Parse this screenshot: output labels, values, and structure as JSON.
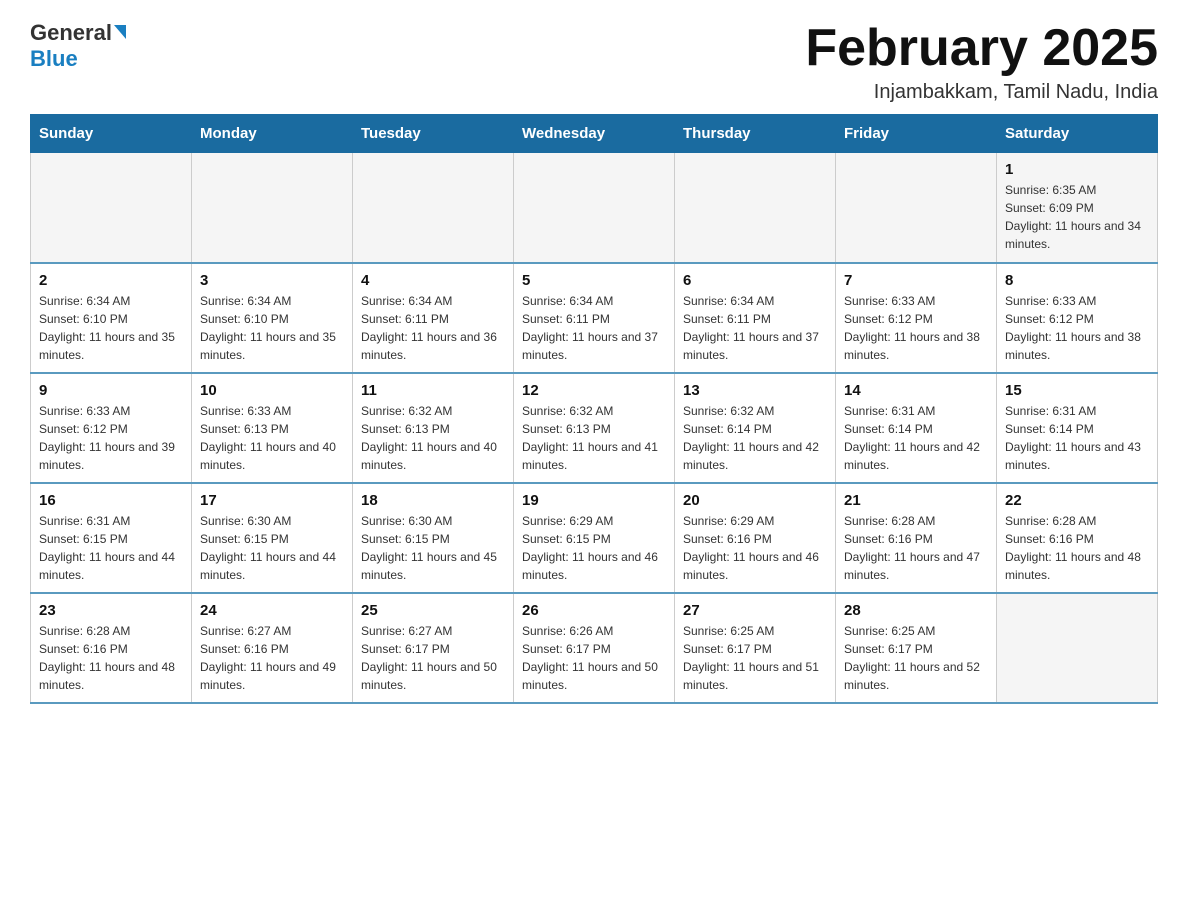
{
  "logo": {
    "general": "General",
    "blue": "Blue"
  },
  "header": {
    "title": "February 2025",
    "subtitle": "Injambakkam, Tamil Nadu, India"
  },
  "days_of_week": [
    "Sunday",
    "Monday",
    "Tuesday",
    "Wednesday",
    "Thursday",
    "Friday",
    "Saturday"
  ],
  "weeks": [
    {
      "days": [
        {
          "num": "",
          "info": ""
        },
        {
          "num": "",
          "info": ""
        },
        {
          "num": "",
          "info": ""
        },
        {
          "num": "",
          "info": ""
        },
        {
          "num": "",
          "info": ""
        },
        {
          "num": "",
          "info": ""
        },
        {
          "num": "1",
          "info": "Sunrise: 6:35 AM\nSunset: 6:09 PM\nDaylight: 11 hours and 34 minutes."
        }
      ]
    },
    {
      "days": [
        {
          "num": "2",
          "info": "Sunrise: 6:34 AM\nSunset: 6:10 PM\nDaylight: 11 hours and 35 minutes."
        },
        {
          "num": "3",
          "info": "Sunrise: 6:34 AM\nSunset: 6:10 PM\nDaylight: 11 hours and 35 minutes."
        },
        {
          "num": "4",
          "info": "Sunrise: 6:34 AM\nSunset: 6:11 PM\nDaylight: 11 hours and 36 minutes."
        },
        {
          "num": "5",
          "info": "Sunrise: 6:34 AM\nSunset: 6:11 PM\nDaylight: 11 hours and 37 minutes."
        },
        {
          "num": "6",
          "info": "Sunrise: 6:34 AM\nSunset: 6:11 PM\nDaylight: 11 hours and 37 minutes."
        },
        {
          "num": "7",
          "info": "Sunrise: 6:33 AM\nSunset: 6:12 PM\nDaylight: 11 hours and 38 minutes."
        },
        {
          "num": "8",
          "info": "Sunrise: 6:33 AM\nSunset: 6:12 PM\nDaylight: 11 hours and 38 minutes."
        }
      ]
    },
    {
      "days": [
        {
          "num": "9",
          "info": "Sunrise: 6:33 AM\nSunset: 6:12 PM\nDaylight: 11 hours and 39 minutes."
        },
        {
          "num": "10",
          "info": "Sunrise: 6:33 AM\nSunset: 6:13 PM\nDaylight: 11 hours and 40 minutes."
        },
        {
          "num": "11",
          "info": "Sunrise: 6:32 AM\nSunset: 6:13 PM\nDaylight: 11 hours and 40 minutes."
        },
        {
          "num": "12",
          "info": "Sunrise: 6:32 AM\nSunset: 6:13 PM\nDaylight: 11 hours and 41 minutes."
        },
        {
          "num": "13",
          "info": "Sunrise: 6:32 AM\nSunset: 6:14 PM\nDaylight: 11 hours and 42 minutes."
        },
        {
          "num": "14",
          "info": "Sunrise: 6:31 AM\nSunset: 6:14 PM\nDaylight: 11 hours and 42 minutes."
        },
        {
          "num": "15",
          "info": "Sunrise: 6:31 AM\nSunset: 6:14 PM\nDaylight: 11 hours and 43 minutes."
        }
      ]
    },
    {
      "days": [
        {
          "num": "16",
          "info": "Sunrise: 6:31 AM\nSunset: 6:15 PM\nDaylight: 11 hours and 44 minutes."
        },
        {
          "num": "17",
          "info": "Sunrise: 6:30 AM\nSunset: 6:15 PM\nDaylight: 11 hours and 44 minutes."
        },
        {
          "num": "18",
          "info": "Sunrise: 6:30 AM\nSunset: 6:15 PM\nDaylight: 11 hours and 45 minutes."
        },
        {
          "num": "19",
          "info": "Sunrise: 6:29 AM\nSunset: 6:15 PM\nDaylight: 11 hours and 46 minutes."
        },
        {
          "num": "20",
          "info": "Sunrise: 6:29 AM\nSunset: 6:16 PM\nDaylight: 11 hours and 46 minutes."
        },
        {
          "num": "21",
          "info": "Sunrise: 6:28 AM\nSunset: 6:16 PM\nDaylight: 11 hours and 47 minutes."
        },
        {
          "num": "22",
          "info": "Sunrise: 6:28 AM\nSunset: 6:16 PM\nDaylight: 11 hours and 48 minutes."
        }
      ]
    },
    {
      "days": [
        {
          "num": "23",
          "info": "Sunrise: 6:28 AM\nSunset: 6:16 PM\nDaylight: 11 hours and 48 minutes."
        },
        {
          "num": "24",
          "info": "Sunrise: 6:27 AM\nSunset: 6:16 PM\nDaylight: 11 hours and 49 minutes."
        },
        {
          "num": "25",
          "info": "Sunrise: 6:27 AM\nSunset: 6:17 PM\nDaylight: 11 hours and 50 minutes."
        },
        {
          "num": "26",
          "info": "Sunrise: 6:26 AM\nSunset: 6:17 PM\nDaylight: 11 hours and 50 minutes."
        },
        {
          "num": "27",
          "info": "Sunrise: 6:25 AM\nSunset: 6:17 PM\nDaylight: 11 hours and 51 minutes."
        },
        {
          "num": "28",
          "info": "Sunrise: 6:25 AM\nSunset: 6:17 PM\nDaylight: 11 hours and 52 minutes."
        },
        {
          "num": "",
          "info": ""
        }
      ]
    }
  ]
}
